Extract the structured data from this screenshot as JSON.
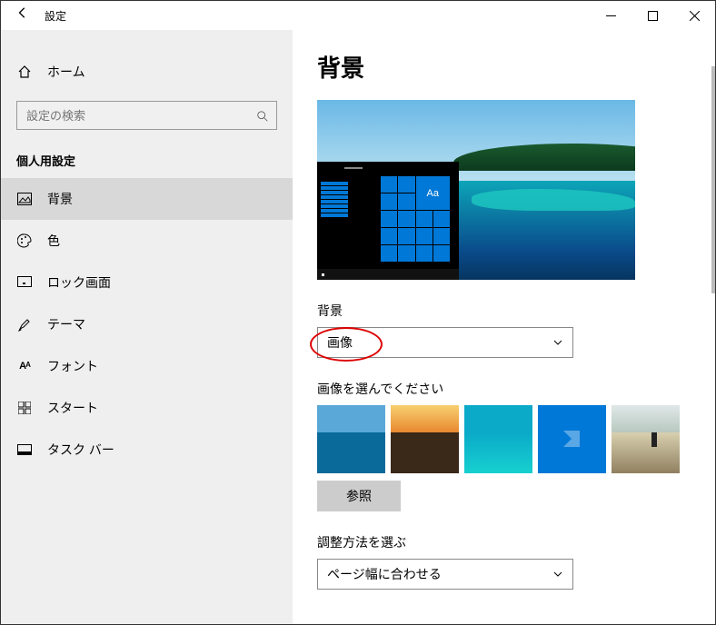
{
  "window": {
    "title": "設定"
  },
  "sidebar": {
    "home": "ホーム",
    "search_placeholder": "設定の検索",
    "section": "個人用設定",
    "items": [
      {
        "label": "背景"
      },
      {
        "label": "色"
      },
      {
        "label": "ロック画面"
      },
      {
        "label": "テーマ"
      },
      {
        "label": "フォント"
      },
      {
        "label": "スタート"
      },
      {
        "label": "タスク バー"
      }
    ]
  },
  "main": {
    "title": "背景",
    "bg_label": "背景",
    "bg_select_value": "画像",
    "preview_tile_text": "Aa",
    "choose_label": "画像を選んでください",
    "browse": "参照",
    "fit_label": "調整方法を選ぶ",
    "fit_value": "ページ幅に合わせる"
  }
}
